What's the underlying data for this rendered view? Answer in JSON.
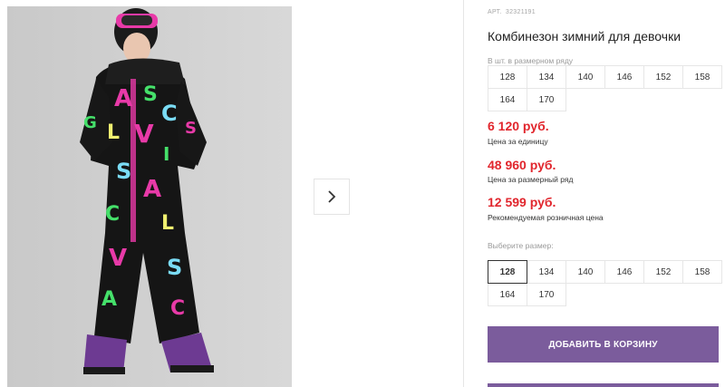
{
  "product": {
    "art_label": "АРТ.",
    "art_number": "32321191",
    "title": "Комбинезон зимний для девочки"
  },
  "gallery": {
    "image_icon": "girl-in-snowsuit-photo",
    "next_icon": "chevron-right-icon"
  },
  "row_sizes": {
    "label": "В шт. в размерном ряду",
    "sizes": [
      "128",
      "134",
      "140",
      "146",
      "152",
      "158",
      "164",
      "170"
    ]
  },
  "prices": [
    {
      "value": "6 120 руб.",
      "note": "Цена за единицу"
    },
    {
      "value": "48 960 руб.",
      "note": "Цена за размерный ряд"
    },
    {
      "value": "12 599 руб.",
      "note": "Рекомендуемая розничная цена"
    }
  ],
  "size_select": {
    "label": "Выберите размер:",
    "sizes": [
      "128",
      "134",
      "140",
      "146",
      "152",
      "158",
      "164",
      "170"
    ],
    "selected": "128"
  },
  "cart": {
    "button_label": "ДОБАВИТЬ В КОРЗИНУ"
  },
  "colors": {
    "price_red": "#e1262d",
    "button_purple": "#7b5c9c"
  }
}
